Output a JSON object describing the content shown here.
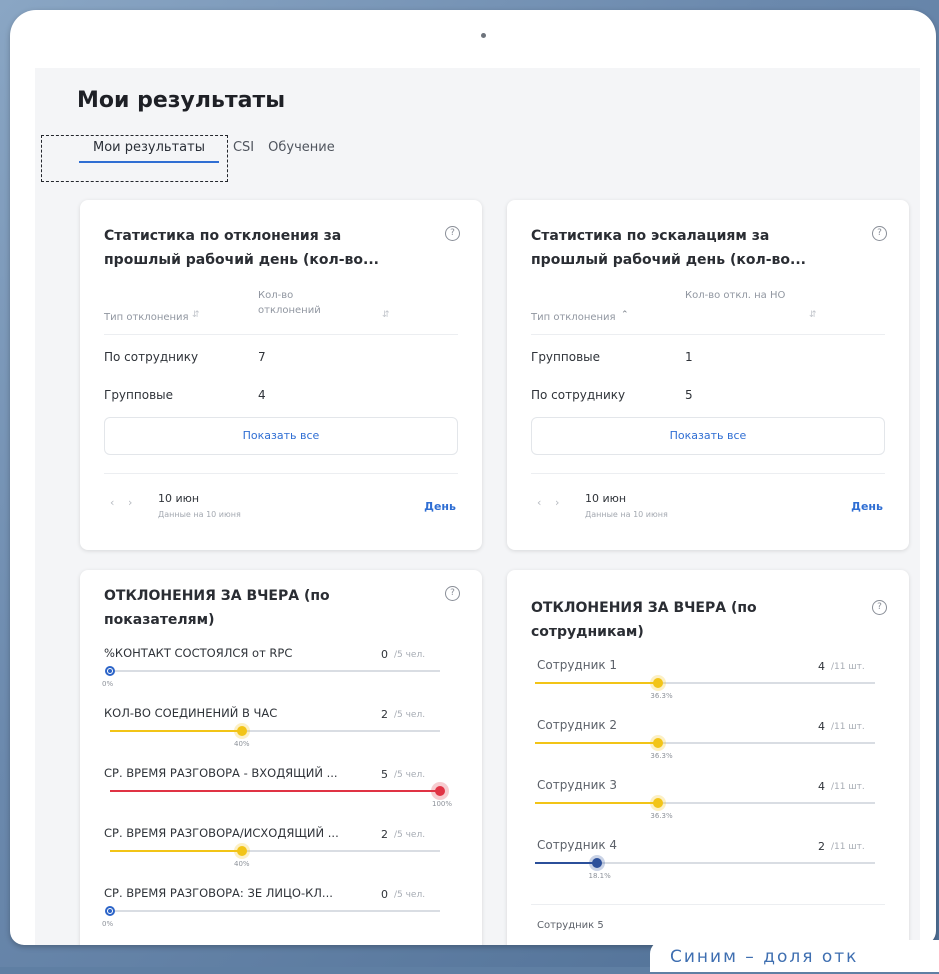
{
  "page": {
    "title": "Мои результаты"
  },
  "tabs": [
    {
      "label": "Мои результаты",
      "active": true
    },
    {
      "label": "CSI",
      "active": false
    },
    {
      "label": "Обучение",
      "active": false
    }
  ],
  "cards": {
    "deviations_stats": {
      "title": "Статистика по отклонения за прошлый рабочий день (кол-во...",
      "col1": "Тип отклонения",
      "col2": "Кол-во отклонений",
      "rows": [
        {
          "type": "По сотруднику",
          "count": "7"
        },
        {
          "type": "Групповые",
          "count": "4"
        }
      ],
      "show_all": "Показать все",
      "date": "10 июн",
      "date_sub": "Данные на 10 июня",
      "period": "День"
    },
    "escalations_stats": {
      "title": "Статистика по эскалациям за прошлый рабочий день (кол-во...",
      "col1": "Тип отклонения",
      "col2": "Кол-во откл. на НО",
      "rows": [
        {
          "type": "Групповые",
          "count": "1"
        },
        {
          "type": "По сотруднику",
          "count": "5"
        }
      ],
      "show_all": "Показать все",
      "date": "10 июн",
      "date_sub": "Данные на 10 июня",
      "period": "День"
    },
    "by_metrics": {
      "title": "ОТКЛОНЕНИЯ ЗА ВЧЕРА (по показателям)",
      "unit": "/5 чел.",
      "items": [
        {
          "label": "%КОНТАКТ СОСТОЯЛСЯ от RPC",
          "value": "0",
          "percent_label": "0%",
          "fraction": 0.0,
          "color": "blue"
        },
        {
          "label": "КОЛ-ВО СОЕДИНЕНИЙ В ЧАС",
          "value": "2",
          "percent_label": "40%",
          "fraction": 0.4,
          "color": "yellow"
        },
        {
          "label": "СР. ВРЕМЯ РАЗГОВОРА - ВХОДЯЩИЙ ...",
          "value": "5",
          "percent_label": "100%",
          "fraction": 1.0,
          "color": "red"
        },
        {
          "label": "СР. ВРЕМЯ РАЗГОВОРА/ИСХОДЯЩИЙ ...",
          "value": "2",
          "percent_label": "40%",
          "fraction": 0.4,
          "color": "yellow"
        },
        {
          "label": "СР. ВРЕМЯ РАЗГОВОРА: ЗЕ ЛИЦО-КЛ...",
          "value": "0",
          "percent_label": "0%",
          "fraction": 0.0,
          "color": "blue"
        }
      ]
    },
    "by_employees": {
      "title": "ОТКЛОНЕНИЯ ЗА ВЧЕРА (по сотрудникам)",
      "unit": "/11 шт.",
      "items": [
        {
          "label": "Сотрудник 1",
          "value": "4",
          "percent_label": "36.3%",
          "fraction": 0.363,
          "color": "yellow"
        },
        {
          "label": "Сотрудник 2",
          "value": "4",
          "percent_label": "36.3%",
          "fraction": 0.363,
          "color": "yellow"
        },
        {
          "label": "Сотрудник 3",
          "value": "4",
          "percent_label": "36.3%",
          "fraction": 0.363,
          "color": "yellow"
        },
        {
          "label": "Сотрудник 4",
          "value": "2",
          "percent_label": "18.1%",
          "fraction": 0.181,
          "color": "navy"
        }
      ],
      "last_label": "Сотрудник 5"
    }
  },
  "caption": "Синим – доля отк",
  "colors": {
    "accent": "#2f6ed3",
    "yellow": "#f2c417",
    "red": "#e03344",
    "navy": "#2b4f9a",
    "track": "#d9dde3"
  }
}
